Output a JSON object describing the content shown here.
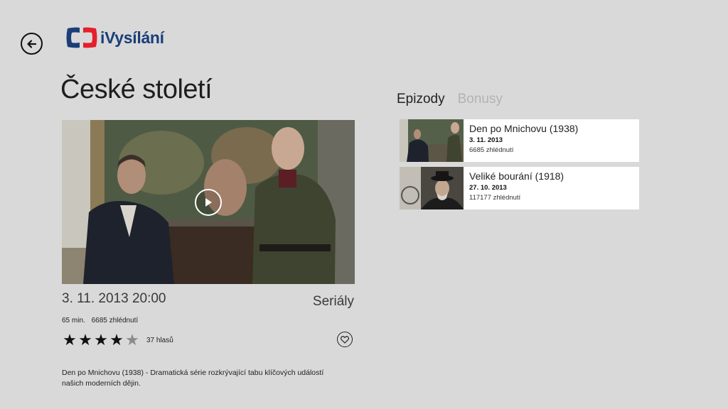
{
  "app": {
    "logo_text": "iVysílání",
    "brand_colors": {
      "blue": "#1a3e78",
      "red": "#e3202b"
    }
  },
  "nav": {
    "back_icon": "back-arrow-icon"
  },
  "show": {
    "title": "České století",
    "air_date": "3. 11. 2013 20:00",
    "category": "Seriály",
    "duration": "65 min.",
    "views": "6685 zhlédnutí",
    "rating": {
      "value": 4,
      "max": 5,
      "votes": "37 hlasů"
    },
    "description": "Den po Mnichovu (1938) - Dramatická série rozkrývající tabu klíčových událostí našich moderních dějin.",
    "play_icon": "play-icon",
    "favorite_icon": "heart-icon"
  },
  "tabs": [
    {
      "label": "Epizody",
      "active": true
    },
    {
      "label": "Bonusy",
      "active": false
    }
  ],
  "episodes": [
    {
      "title": "Den po Mnichovu (1938)",
      "date": "3. 11. 2013",
      "views": "6685 zhlédnutí"
    },
    {
      "title": "Veliké bourání (1918)",
      "date": "27. 10. 2013",
      "views": "117177 zhlédnutí"
    }
  ]
}
